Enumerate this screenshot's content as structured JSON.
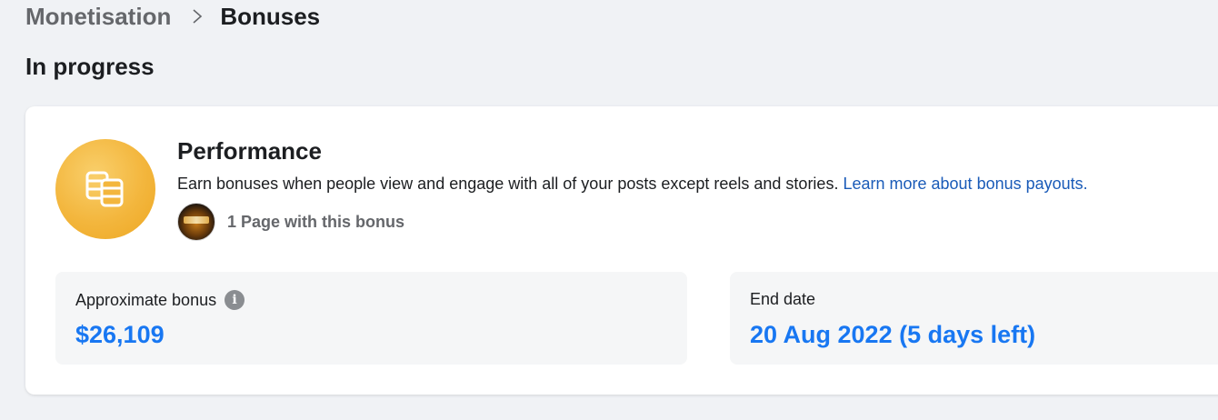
{
  "breadcrumb": {
    "parent": "Monetisation",
    "current": "Bonuses",
    "separator_icon": "chevron-right-icon"
  },
  "section": {
    "title": "In progress"
  },
  "bonus_card": {
    "icon": "coins-icon",
    "title": "Performance",
    "description": "Earn bonuses when people view and engage with all of your posts except reels and stories.",
    "link_text": "Learn more about bonus payouts.",
    "pages_text": "1 Page with this bonus",
    "approx_label": "Approximate bonus",
    "approx_value": "$26,109",
    "end_date_label": "End date",
    "end_date_value": "20 Aug 2022 (5 days left)",
    "accent_color": "#1877f2",
    "coin_color": "#f3b63d"
  }
}
